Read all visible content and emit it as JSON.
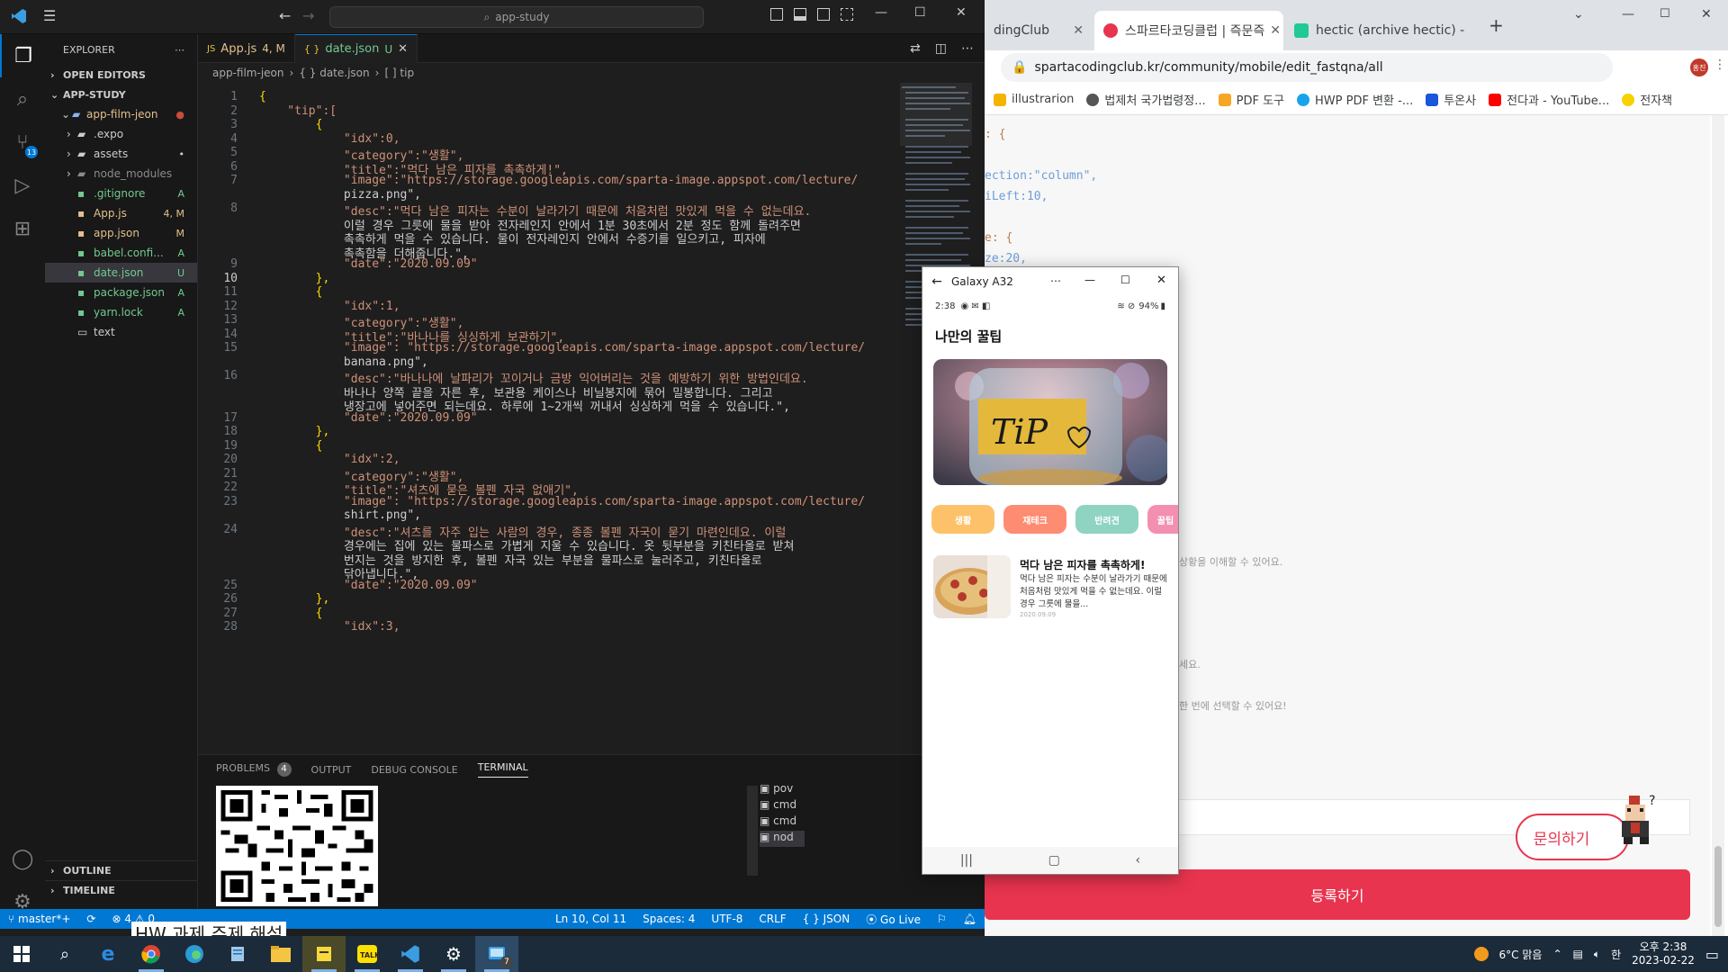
{
  "chrome": {
    "tabs": [
      {
        "label": "dingClub",
        "active": false
      },
      {
        "label": "스파르타코딩클럽 | 즉문즉",
        "active": true
      },
      {
        "label": "hectic (archive hectic) - vel",
        "active": false
      }
    ],
    "url": "spartacodingclub.kr/community/mobile/edit_fastqna/all",
    "avatar_text": "홍진",
    "bookmarks": [
      "illustrarion",
      "법제처 국가법령정...",
      "PDF 도구",
      "HWP PDF 변환 -...",
      "투온사",
      "전다과 - YouTube...",
      "전자책"
    ],
    "page_snippets": {
      "code1": ": {",
      "code2": "ection:\"column\",",
      "code3": "iLeft:10,",
      "code4": "e: {",
      "code5": "ze:20,",
      "hint1": "상황을 이해할 수 있어요.",
      "hint2": "세요.",
      "hint3": "한 번에 선택할 수 있어요!"
    },
    "ask_button": "문의하기",
    "submit_button": "등록하기"
  },
  "vscode": {
    "search": "app-study",
    "explorer_title": "EXPLORER",
    "open_editors": "OPEN EDITORS",
    "workspace": "APP-STUDY",
    "folder": "app-film-jeon",
    "tree": [
      {
        "name": ".expo",
        "badge": "",
        "type": "folder",
        "color": "#cccccc"
      },
      {
        "name": "assets",
        "badge": "•",
        "type": "folder",
        "color": "#cccccc"
      },
      {
        "name": "node_modules",
        "badge": "",
        "type": "folder",
        "color": "#8b8b8b"
      },
      {
        "name": ".gitignore",
        "badge": "A",
        "type": "file",
        "color": "#73c991"
      },
      {
        "name": "App.js",
        "badge": "4, M",
        "type": "file",
        "color": "#e2c08d"
      },
      {
        "name": "app.json",
        "badge": "M",
        "type": "file",
        "color": "#e2c08d"
      },
      {
        "name": "babel.confi...",
        "badge": "A",
        "type": "file",
        "color": "#73c991"
      },
      {
        "name": "date.json",
        "badge": "U",
        "type": "file",
        "color": "#73c991"
      },
      {
        "name": "package.json",
        "badge": "A",
        "type": "file",
        "color": "#73c991"
      },
      {
        "name": "yarn.lock",
        "badge": "A",
        "type": "file",
        "color": "#73c991"
      }
    ],
    "text_file": "text",
    "outline": "OUTLINE",
    "timeline": "TIMELINE",
    "tabs": [
      {
        "name": "App.js",
        "status": "4, M",
        "active": false
      },
      {
        "name": "date.json",
        "status": "U",
        "active": true
      }
    ],
    "breadcrumbs": [
      "app-film-jeon",
      "{ } date.json",
      "[ ] tip"
    ],
    "line_numbers": [
      "1",
      "2",
      "3",
      "4",
      "5",
      "6",
      "7",
      "",
      "8",
      "",
      "",
      "",
      "9",
      "10",
      "11",
      "12",
      "13",
      "14",
      "15",
      "",
      "16",
      "",
      "",
      "17",
      "18",
      "19",
      "20",
      "21",
      "22",
      "23",
      "",
      "24",
      "",
      "",
      "",
      "25",
      "26",
      "27",
      "28"
    ],
    "code_lines": [
      "{",
      "    \"tip\":[",
      "        {",
      "            \"idx\":0,",
      "            \"category\":\"생활\",",
      "            \"title\":\"먹다 남은 피자를 촉촉하게!\",",
      "            \"image\":\"https://storage.googleapis.com/sparta-image.appspot.com/lecture/",
      "            pizza.png\",",
      "            \"desc\":\"먹다 남은 피자는 수분이 날라가기 때문에 처음처럼 맛있게 먹을 수 없는데요.",
      "            이럴 경우 그릇에 물을 받아 전자레인지 안에서 1분 30초에서 2분 정도 함께 돌려주면",
      "            촉촉하게 먹을 수 있습니다. 물이 전자레인지 안에서 수증기를 일으키고, 피자에",
      "            촉촉함을 더해줍니다.\",",
      "            \"date\":\"2020.09.09\"",
      "        },",
      "        {",
      "            \"idx\":1,",
      "            \"category\":\"생활\",",
      "            \"title\":\"바나나를 싱싱하게 보관하기\",",
      "            \"image\": \"https://storage.googleapis.com/sparta-image.appspot.com/lecture/",
      "            banana.png\",",
      "            \"desc\":\"바나나에 날파리가 꼬이거나 금방 익어버리는 것을 예방하기 위한 방법인데요.",
      "            바나나 양쪽 끝을 자른 후, 보관용 케이스나 비닐봉지에 묶어 밀봉합니다. 그리고",
      "            냉장고에 넣어주면 되는데요. 하루에 1~2개씩 꺼내서 싱싱하게 먹을 수 있습니다.\",",
      "            \"date\":\"2020.09.09\"",
      "        },",
      "        {",
      "            \"idx\":2,",
      "            \"category\":\"생활\",",
      "            \"title\":\"셔츠에 묻은 볼펜 자국 없애기\",",
      "            \"image\": \"https://storage.googleapis.com/sparta-image.appspot.com/lecture/",
      "            shirt.png\",",
      "            \"desc\":\"셔츠를 자주 입는 사람의 경우, 종종 볼펜 자국이 묻기 마련인데요. 이럴",
      "            경우에는 집에 있는 물파스로 가볍게 지울 수 있습니다. 옷 뒷부분을 키친타올로 받쳐",
      "            번지는 것을 방지한 후, 볼펜 자국 있는 부분을 물파스로 눌러주고, 키친타올로",
      "            닦아냅니다.\",",
      "            \"date\":\"2020.09.09\"",
      "        },",
      "        {",
      "            \"idx\":3,"
    ],
    "panel_tabs": [
      "PROBLEMS",
      "OUTPUT",
      "DEBUG CONSOLE",
      "TERMINAL"
    ],
    "problems_count": "4",
    "terminals": [
      "pov",
      "cmd",
      "cmd",
      "nod"
    ],
    "status": {
      "branch": "master*+",
      "errors": "⊗ 4 ⚠ 0",
      "position": "Ln 10, Col 11",
      "spaces": "Spaces: 4",
      "encoding": "UTF-8",
      "eol": "CRLF",
      "language": "{ } JSON",
      "golive": "Go Live"
    },
    "overflow_text": "HW 과제 주제 해설"
  },
  "emulator": {
    "window_title": "Galaxy A32",
    "status_time": "2:38",
    "battery": "94%",
    "page_title": "나만의 꿀팁",
    "hero_text": "TiP",
    "categories": [
      {
        "label": "생활",
        "color": "#fdc269"
      },
      {
        "label": "재테크",
        "color": "#fd8c73"
      },
      {
        "label": "반려견",
        "color": "#8fd3c3"
      },
      {
        "label": "꿀팁",
        "color": "#f38fb0"
      }
    ],
    "card": {
      "title": "먹다 남은 피자를 촉촉하게!",
      "desc": "먹다 남은 피자는 수분이 날라가기 때문에 처음처럼 맛있게 먹을 수 없는데요. 이럴 경우 그릇에 물을...",
      "date": "2020.09.09"
    }
  },
  "taskbar": {
    "weather": "6°C 맑음",
    "time": "오후 2:38",
    "date": "2023-02-22",
    "badge": "7",
    "lang": "한"
  }
}
